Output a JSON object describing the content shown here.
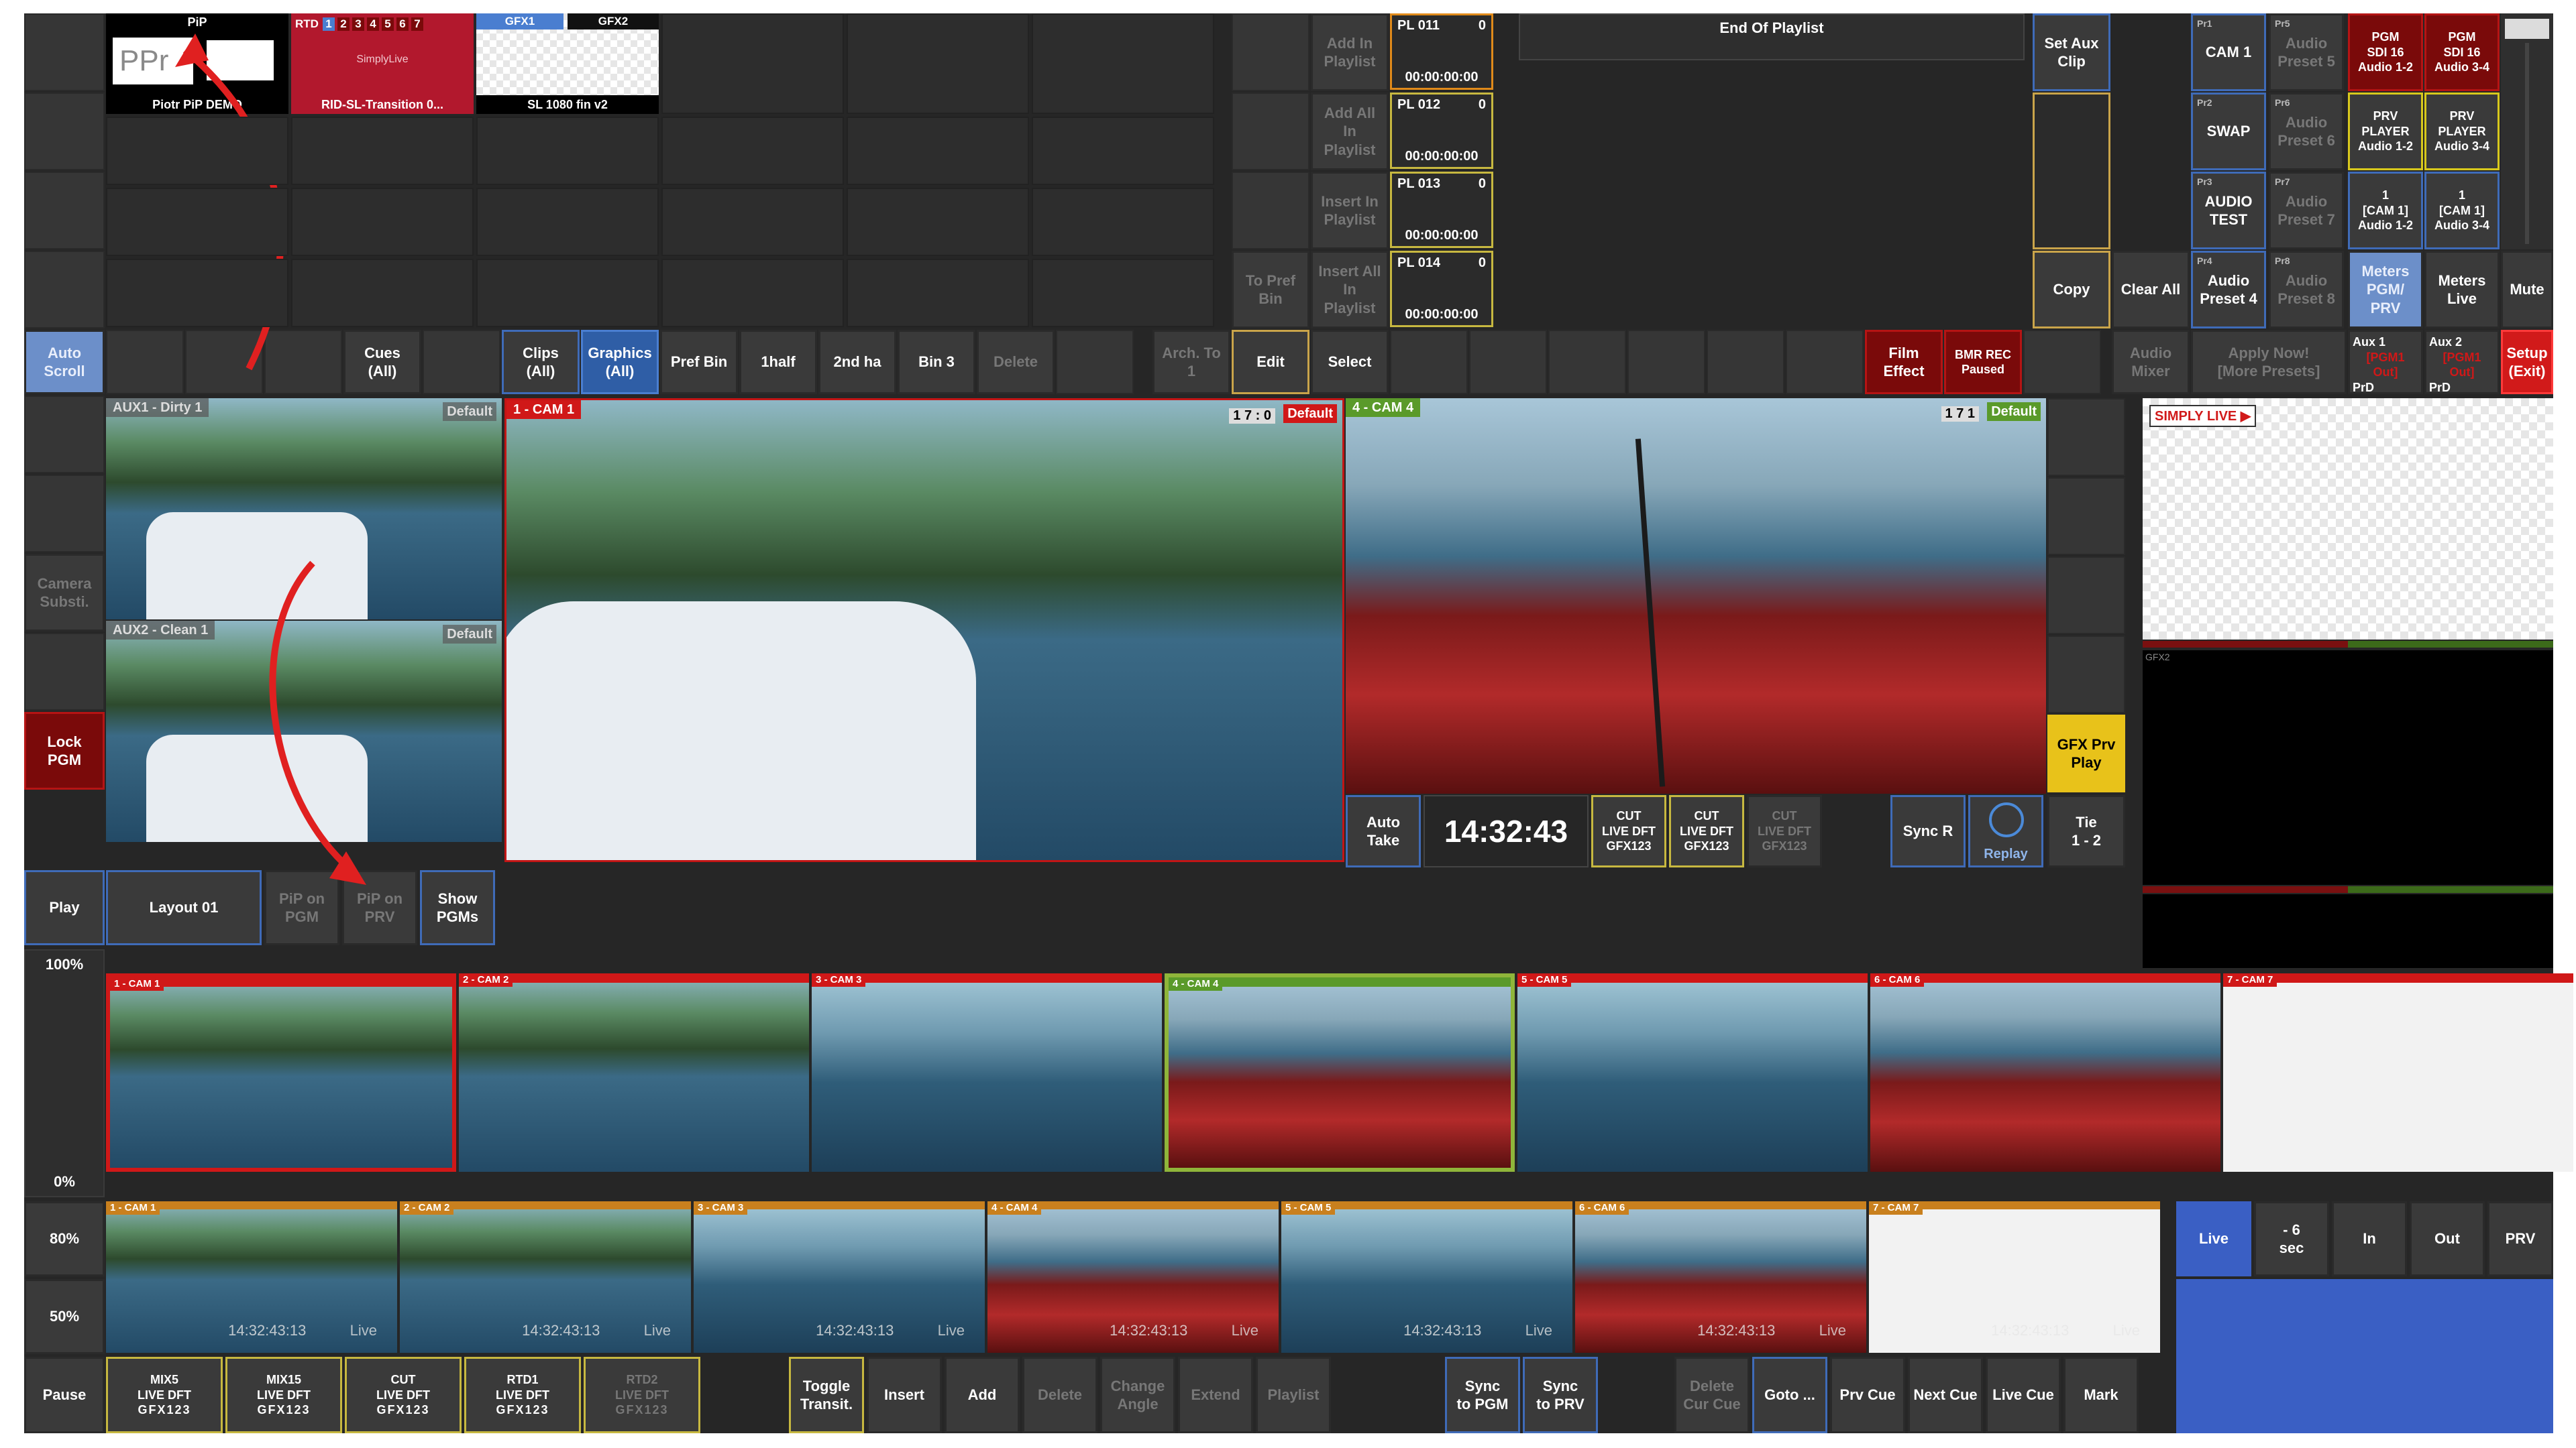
{
  "bins": {
    "pip": {
      "title": "PiP",
      "overlay": "PPr",
      "caption": "Piotr PiP DEMO"
    },
    "rtd": {
      "label": "RTD",
      "numbers": [
        "1",
        "2",
        "3",
        "4",
        "5",
        "6",
        "7"
      ],
      "brand": "SimplyLive",
      "caption": "RID-SL-Transition 0..."
    },
    "gfx": {
      "tab1": "GFX1",
      "tab2": "GFX2",
      "caption": "SL 1080 fin v2"
    }
  },
  "edit_column": {
    "add_in_playlist": "Add In\nPlaylist",
    "add_all_in_playlist": "Add All\nIn\nPlaylist",
    "insert_in_playlist": "Insert In\nPlaylist",
    "to_pref_bin": "To Pref\nBin",
    "insert_all_in_playlist": "Insert All\nIn\nPlaylist"
  },
  "playlists": [
    {
      "name": "PL 011",
      "count": "0",
      "time": "00:00:00:00"
    },
    {
      "name": "PL 012",
      "count": "0",
      "time": "00:00:00:00"
    },
    {
      "name": "PL 013",
      "count": "0",
      "time": "00:00:00:00"
    },
    {
      "name": "PL 014",
      "count": "0",
      "time": "00:00:00:00"
    }
  ],
  "end_of_playlist": "End Of Playlist",
  "right_controls": {
    "set_aux_clip": "Set Aux\nClip",
    "copy": "Copy",
    "clear_all": "Clear All",
    "presets": [
      {
        "tag": "Pr1",
        "label": "CAM 1"
      },
      {
        "tag": "Pr5",
        "label": "Audio\nPreset 5"
      },
      {
        "tag": "Pr2",
        "label": "SWAP"
      },
      {
        "tag": "Pr6",
        "label": "Audio\nPreset 6"
      },
      {
        "tag": "Pr3",
        "label": "AUDIO\nTEST"
      },
      {
        "tag": "Pr7",
        "label": "Audio\nPreset 7"
      },
      {
        "tag": "Pr4",
        "label": "Audio\nPreset 4"
      },
      {
        "tag": "Pr8",
        "label": "Audio\nPreset 8"
      }
    ],
    "audio_routes": [
      "PGM\nSDI 16\nAudio 1-2",
      "PGM\nSDI 16\nAudio 3-4",
      "PRV\nPLAYER\nAudio 1-2",
      "PRV\nPLAYER\nAudio 3-4",
      "1\n[CAM 1]\nAudio 1-2",
      "1\n[CAM 1]\nAudio 3-4"
    ],
    "meters_pgm_prv": "Meters\nPGM/\nPRV",
    "meters_live": "Meters\nLive",
    "mute": "Mute"
  },
  "toolbar": {
    "auto_scroll": "Auto\nScroll",
    "cues_all": "Cues\n(All)",
    "clips_all": "Clips\n(All)",
    "graphics_all": "Graphics\n(All)",
    "pref_bin": "Pref Bin",
    "bin_1half": "1half",
    "bin_2ndha": "2nd ha",
    "bin_3": "Bin 3",
    "delete": "Delete",
    "arch_to": "Arch. To\n1",
    "edit": "Edit",
    "select": "Select",
    "film_effect": "Film\nEffect",
    "bmr_rec": "BMR REC\nPaused",
    "audio_mixer": "Audio\nMixer",
    "apply_now": "Apply Now!\n[More Presets]",
    "aux1": {
      "title": "Aux 1",
      "sub": "[PGM1 Out]",
      "foot": "PrD"
    },
    "aux2": {
      "title": "Aux 2",
      "sub": "[PGM1 Out]",
      "foot": "PrD"
    },
    "setup_exit": "Setup\n(Exit)"
  },
  "left_column": {
    "camera_subst": "Camera\nSubsti.",
    "lock_pgm": "Lock\nPGM",
    "play": "Play",
    "pause": "Pause",
    "speed_100": "100%",
    "speed_0": "0%",
    "speed_80": "80%",
    "speed_50": "50%"
  },
  "monitors": {
    "aux1": {
      "label": "AUX1 - Dirty 1",
      "badge": "Default"
    },
    "aux2": {
      "label": "AUX2 - Clean 1",
      "badge": "Default"
    },
    "pgm": {
      "label": "1 - CAM 1",
      "ratio": "1 7 : 0",
      "badge": "Default"
    },
    "prv": {
      "label": "4 - CAM 4",
      "ratio": "1 7 1",
      "badge": "Default"
    },
    "gfx_logo": "SIMPLY LIVE ▶",
    "gfx2": "GFX2"
  },
  "layout_row": {
    "layout": "Layout 01",
    "pip_on_pgm": "PiP on\nPGM",
    "pip_on_prv": "PiP on\nPRV",
    "show_pgms": "Show\nPGMs"
  },
  "transport": {
    "auto_take": "Auto\nTake",
    "clock": "14:32:43",
    "cut1": {
      "line1": "CUT",
      "line2": "LIVE DFT",
      "line3": "GFX123"
    },
    "cut2": {
      "line1": "CUT",
      "line2": "LIVE DFT",
      "line3": "GFX123"
    },
    "cut3": {
      "line1": "CUT",
      "line2": "LIVE DFT",
      "line3": "GFX123"
    },
    "sync_r": "Sync R",
    "replay": "Replay",
    "tie": "Tie\n1 - 2",
    "gfx_prv_play": "GFX Prv\nPlay"
  },
  "cameras_live": [
    {
      "label": "1 - CAM 1",
      "color": "#d01818"
    },
    {
      "label": "2 - CAM 2",
      "color": "#d01818"
    },
    {
      "label": "3 - CAM 3",
      "color": "#d01818"
    },
    {
      "label": "4 - CAM 4",
      "color": "#5a9a2a"
    },
    {
      "label": "5 - CAM 5",
      "color": "#d01818"
    },
    {
      "label": "6 - CAM 6",
      "color": "#d01818"
    },
    {
      "label": "7 - CAM 7",
      "color": "#d01818"
    }
  ],
  "cameras_replay": [
    {
      "label": "1 - CAM 1",
      "tc": "14:32:43:13",
      "state": "Live"
    },
    {
      "label": "2 - CAM 2",
      "tc": "14:32:43:13",
      "state": "Live"
    },
    {
      "label": "3 - CAM 3",
      "tc": "14:32:43:13",
      "state": "Live"
    },
    {
      "label": "4 - CAM 4",
      "tc": "14:32:43:13",
      "state": "Live"
    },
    {
      "label": "5 - CAM 5",
      "tc": "14:32:43:13",
      "state": "Live"
    },
    {
      "label": "6 - CAM 6",
      "tc": "14:32:43:13",
      "state": "Live"
    },
    {
      "label": "7 - CAM 7",
      "tc": "14:32:43:13",
      "state": "Live"
    }
  ],
  "replay_nav": {
    "live": "Live",
    "minus6": "- 6\nsec",
    "in": "In",
    "out": "Out",
    "prv": "PRV"
  },
  "bottom_row": {
    "mix5": {
      "line1": "MIX5",
      "line2": "LIVE DFT",
      "line3": "GFX123"
    },
    "mix15": {
      "line1": "MIX15",
      "line2": "LIVE DFT",
      "line3": "GFX123"
    },
    "cut": {
      "line1": "CUT",
      "line2": "LIVE DFT",
      "line3": "GFX123"
    },
    "rtd1": {
      "line1": "RTD1",
      "line2": "LIVE DFT",
      "line3": "GFX123"
    },
    "rtd2": {
      "line1": "RTD2",
      "line2": "LIVE DFT",
      "line3": "GFX123"
    },
    "toggle_transit": "Toggle\nTransit.",
    "insert": "Insert",
    "add": "Add",
    "delete": "Delete",
    "change_angle": "Change\nAngle",
    "extend": "Extend",
    "playlist": "Playlist",
    "sync_pgm": "Sync\nto PGM",
    "sync_prv": "Sync\nto PRV",
    "delete_cur_cue": "Delete\nCur Cue",
    "goto": "Goto ...",
    "prv_cue": "Prv Cue",
    "next_cue": "Next Cue",
    "live_cue": "Live Cue",
    "mark": "Mark"
  },
  "colors": {
    "accent_yellow": "#c7b840",
    "tally_red": "#d01818",
    "tally_green": "#5a9a2a",
    "live_blue": "#2f5ea6",
    "annotation_arrow": "#e02020"
  }
}
